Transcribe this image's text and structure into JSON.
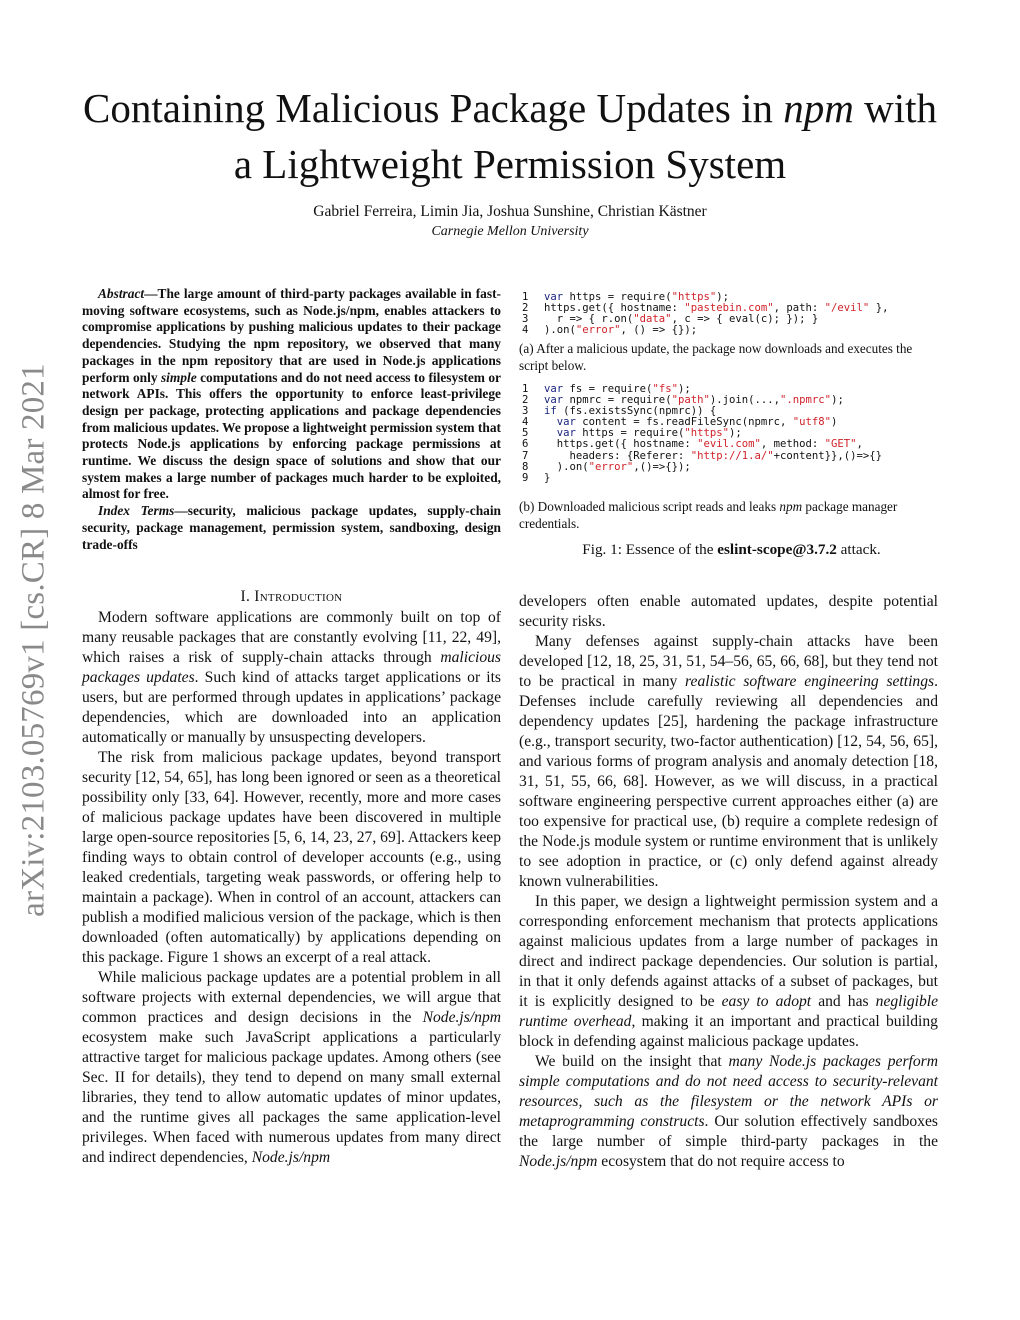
{
  "arxiv_stamp": "arXiv:2103.05769v1  [cs.CR]  8 Mar 2021",
  "title": {
    "line1_before": "Containing Malicious Package Updates in ",
    "line1_italic": "npm",
    "line1_after": " with",
    "line2": "a Lightweight Permission System"
  },
  "authors": "Gabriel Ferreira, Limin Jia, Joshua Sunshine, Christian Kästner",
  "affiliation": "Carnegie Mellon University",
  "abstract": {
    "label": "Abstract",
    "dash": "—",
    "text_1": "The large amount of third-party packages available in fast-moving software ecosystems, such as Node.js/npm, enables attackers to compromise applications by pushing malicious up­dates to their package dependencies. Studying the npm repository, we observed that many packages in the npm repository that are used in Node.js applications perform only ",
    "italic_1": "simple",
    "text_2": " computations and do not need access to filesystem or network APIs. This offers the opportunity to enforce least-privilege design per package, protecting applications and package dependencies from malicious updates. We propose a lightweight permission system that pro­tects Node.js applications by enforcing package permissions at runtime. We discuss the design space of solutions and show that our system makes a large number of packages much harder to be exploited, almost for free.",
    "index_label": "Index Terms",
    "index_text": "security, malicious package updates, supply-chain security, package management, permission system, sand­boxing, design trade-offs"
  },
  "figure": {
    "code_a": [
      {
        "n": "1",
        "parts": [
          [
            "kw",
            "var"
          ],
          [
            "t",
            " https = require("
          ],
          [
            "str",
            "\"https\""
          ],
          [
            "t",
            ");"
          ]
        ]
      },
      {
        "n": "2",
        "parts": [
          [
            "t",
            "https.get({ hostname: "
          ],
          [
            "str",
            "\"pastebin.com\""
          ],
          [
            "t",
            ", path: "
          ],
          [
            "str",
            "\"/evil\""
          ],
          [
            "t",
            " },"
          ]
        ]
      },
      {
        "n": "3",
        "parts": [
          [
            "t",
            "  r => { r.on("
          ],
          [
            "str",
            "\"data\""
          ],
          [
            "t",
            ", c => { eval(c); }); }"
          ]
        ]
      },
      {
        "n": "4",
        "parts": [
          [
            "t",
            ").on("
          ],
          [
            "str",
            "\"error\""
          ],
          [
            "t",
            ", () => {});"
          ]
        ]
      }
    ],
    "caption_a": "(a) After a malicious update, the package now downloads and executes the script below.",
    "code_b": [
      {
        "n": "1",
        "parts": [
          [
            "kw",
            "var"
          ],
          [
            "t",
            " fs = require("
          ],
          [
            "str",
            "\"fs\""
          ],
          [
            "t",
            ");"
          ]
        ]
      },
      {
        "n": "2",
        "parts": [
          [
            "kw",
            "var"
          ],
          [
            "t",
            " npmrc = require("
          ],
          [
            "str",
            "\"path\""
          ],
          [
            "t",
            ").join(...,"
          ],
          [
            "str",
            "\".npmrc\""
          ],
          [
            "t",
            ");"
          ]
        ]
      },
      {
        "n": "3",
        "parts": [
          [
            "kw",
            "if"
          ],
          [
            "t",
            " (fs.existsSync(npmrc)) {"
          ]
        ]
      },
      {
        "n": "4",
        "parts": [
          [
            "t",
            "  "
          ],
          [
            "kw",
            "var"
          ],
          [
            "t",
            " content = fs.readFileSync(npmrc, "
          ],
          [
            "str",
            "\"utf8\""
          ],
          [
            "t",
            ")"
          ]
        ]
      },
      {
        "n": "5",
        "parts": [
          [
            "t",
            "  "
          ],
          [
            "kw",
            "var"
          ],
          [
            "t",
            " https = require("
          ],
          [
            "str",
            "\"https\""
          ],
          [
            "t",
            ");"
          ]
        ]
      },
      {
        "n": "6",
        "parts": [
          [
            "t",
            "  https.get({ hostname: "
          ],
          [
            "str",
            "\"evil.com\""
          ],
          [
            "t",
            ", method: "
          ],
          [
            "str",
            "\"GET\""
          ],
          [
            "t",
            ","
          ]
        ]
      },
      {
        "n": "7",
        "parts": [
          [
            "t",
            "    headers: {Referer: "
          ],
          [
            "str",
            "\"http://1.a/\""
          ],
          [
            "t",
            "+content}},()=>{}"
          ]
        ]
      },
      {
        "n": "8",
        "parts": [
          [
            "t",
            "  ).on("
          ],
          [
            "str",
            "\"error\""
          ],
          [
            "t",
            ",()=>{});"
          ]
        ]
      },
      {
        "n": "9",
        "parts": [
          [
            "t",
            "}"
          ]
        ]
      }
    ],
    "caption_b_before": "(b) Downloaded malicious script reads and leaks ",
    "caption_b_italic": "npm",
    "caption_b_after": " package manager credentials.",
    "fig_label": "Fig. 1: Essence of the ",
    "fig_bold": "eslint-scope@3.7.2",
    "fig_after": " attack."
  },
  "section": {
    "heading": "I. Introduction"
  },
  "left_paragraphs": [
    {
      "segments": [
        [
          "t",
          "Modern software applications are commonly built on top of many reusable packages that are constantly evolving [11, 22, 49], which raises a risk of supply-chain attacks through "
        ],
        [
          "i",
          "mali­cious packages updates"
        ],
        [
          "t",
          ". Such kind of attacks target applications or its users, but are performed through updates in applications’ package dependencies, which are downloaded into an applica­tion automatically or manually by unsuspecting developers."
        ]
      ]
    },
    {
      "segments": [
        [
          "t",
          "The risk from malicious package updates, beyond transport security [12, 54, 65], has long been ignored or seen as a theoretical possibility only [33, 64]. However, recently, more and more cases of malicious package updates have been discovered in multiple large open-source repositories [5, 6, 14, 23, 27, 69]. Attackers keep finding ways to obtain control of developer accounts (e.g., using leaked credentials, targeting weak passwords, or offering help to maintain a package). When in control of an account, attackers can publish a modified malicious version of the package, which is then downloaded (often automatically) by applications depending on this package. Figure 1 shows an excerpt of a real attack."
        ]
      ]
    },
    {
      "segments": [
        [
          "t",
          "While malicious package updates are a potential problem in all software projects with external dependencies, we will argue that common practices and design decisions in the "
        ],
        [
          "i",
          "Node.js/npm"
        ],
        [
          "t",
          " ecosystem make such JavaScript applications a particularly attractive target for malicious package updates. Among others (see Sec. II for details), they tend to depend on many small external libraries, they tend to allow automatic updates of minor updates, and the runtime gives all packages the same application-level privileges. When faced with numerous updates from many direct and indirect dependencies, "
        ],
        [
          "i",
          "Node.js/npm"
        ]
      ]
    }
  ],
  "right_paragraphs": [
    {
      "cont": true,
      "segments": [
        [
          "t",
          "developers often enable automated updates, despite potential security risks."
        ]
      ]
    },
    {
      "segments": [
        [
          "t",
          "Many defenses against supply-chain attacks have been developed  [12, 18, 25, 31, 51, 54–56, 65, 66, 68], but they tend not to be practical in many "
        ],
        [
          "i",
          "realistic software engineering settings"
        ],
        [
          "t",
          ". Defenses include carefully reviewing all dependen­cies and dependency updates [25], hardening the package infrastructure (e.g., transport security, two-factor authentica­tion) [12, 54, 56, 65], and various forms of program analysis and anomaly detection [18, 31, 51, 55, 66, 68]. However, as we will discuss, in a practical software engineering perspective current approaches either (a) are too expensive for practical use, (b) require a complete redesign of the Node.js module system or runtime environment that is unlikely to see adoption in practice, or (c) only defend against already known vulnerabilities."
        ]
      ]
    },
    {
      "segments": [
        [
          "t",
          "In this paper, we design a lightweight permission system and a corresponding enforcement mechanism that protects applications against malicious updates from a large number of packages in direct and indirect package dependencies. Our solution is partial, in that it only defends against attacks of a subset of packages, but it is explicitly designed to be "
        ],
        [
          "i",
          "easy to adopt"
        ],
        [
          "t",
          " and has "
        ],
        [
          "i",
          "negligible runtime overhead"
        ],
        [
          "t",
          ", making it an important and practical building block in defending against malicious package updates."
        ]
      ]
    },
    {
      "segments": [
        [
          "t",
          "We build on the insight that "
        ],
        [
          "i",
          "many Node.js packages perform simple computations and do not need access to security-relevant resources, such as the filesystem or the network APIs or metaprogramming constructs"
        ],
        [
          "t",
          ". Our solution effectively sandboxes the large number of simple third-party packages in the "
        ],
        [
          "i",
          "Node.js/npm"
        ],
        [
          "t",
          " ecosystem that do not require access to"
        ]
      ]
    }
  ]
}
